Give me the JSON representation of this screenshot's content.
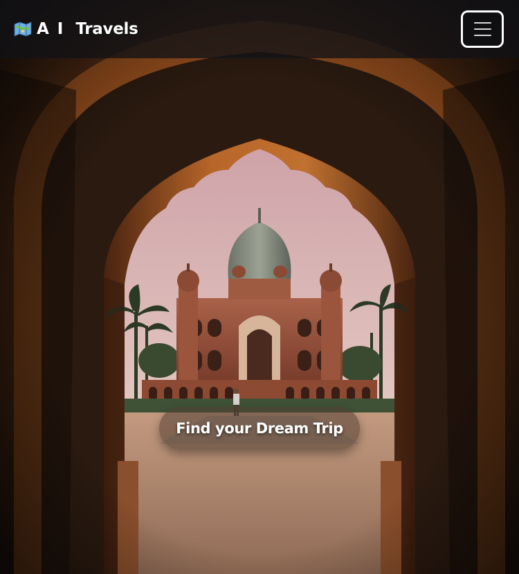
{
  "navbar": {
    "brand_icon": "map-icon",
    "brand_prefix": "A I",
    "brand_name": "Travels",
    "menu_icon": "hamburger-menu-icon"
  },
  "hero": {
    "background_image": "tomb-through-sandstone-arch-photo",
    "cta_label": "Find your Dream Trip"
  },
  "colors": {
    "navbar_bg": "#121216",
    "text": "#ffffff",
    "arch_stone": "#b3652a",
    "sky": "#d9b6b2"
  }
}
